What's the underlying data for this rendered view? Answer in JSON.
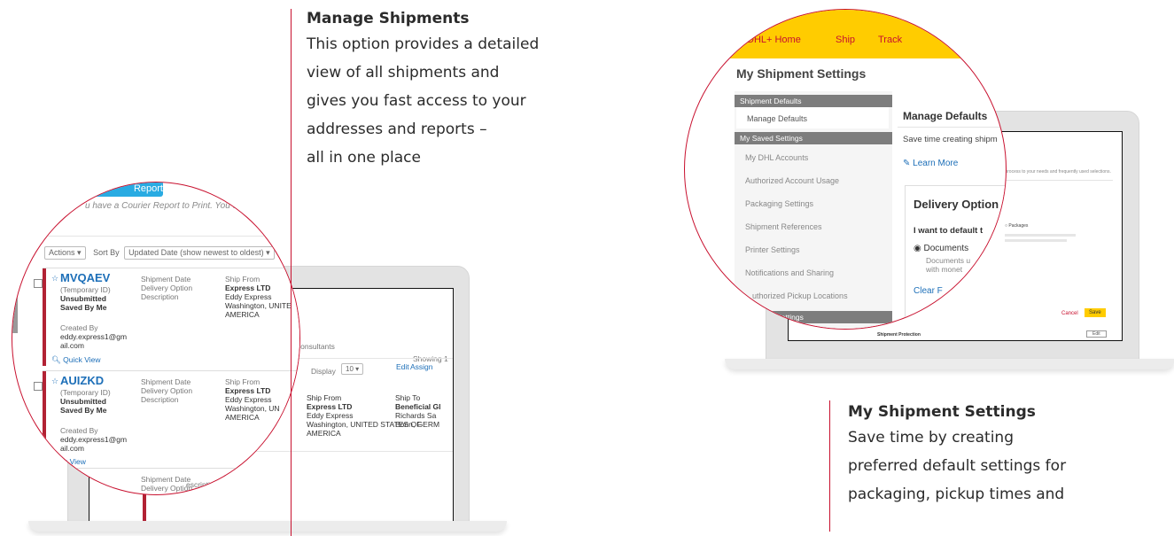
{
  "captions": {
    "manage": {
      "title": "Manage Shipments",
      "lines": [
        "This option provides a detailed",
        "view of all shipments and",
        "gives you fast access to your",
        "addresses and reports –",
        "all in one place"
      ]
    },
    "settings": {
      "title": "My Shipment Settings",
      "lines": [
        "Save time by creating",
        "preferred default settings for",
        "packaging, pickup times and"
      ]
    }
  },
  "colors": {
    "accent": "#c8102e",
    "dhl_yellow": "#ffcc00",
    "link": "#1d6fb8"
  },
  "left_zoom": {
    "top_button": "Report",
    "notice": "u have a Courier Report to Print. You do not have any",
    "toolbar": {
      "actions": "Actions ▾",
      "sort_by": "Sort By",
      "sort_value": "Updated Date (show newest to oldest)  ▾"
    },
    "shipments": [
      {
        "id": "MVQAEV",
        "temp_id": "(Temporary ID)",
        "status": "Unsubmitted",
        "saved_by": "Saved By Me",
        "fields": [
          "Shipment Date",
          "Delivery Option",
          "Description"
        ],
        "ship_from_label": "Ship From",
        "ship_from": [
          "Express LTD",
          "Eddy Express",
          "Washington, UNITE",
          "AMERICA"
        ],
        "created_label": "Created By",
        "created_by": "eddy.express1@gm",
        "created_by2": "ail.com",
        "quick_view": "Quick View"
      },
      {
        "id": "AUIZKD",
        "temp_id": "(Temporary ID)",
        "status": "Unsubmitted",
        "saved_by": "Saved By Me",
        "fields": [
          "Shipment Date",
          "Delivery Option",
          "Description"
        ],
        "ship_from_label": "Ship From",
        "ship_from": [
          "Express LTD",
          "Eddy Express",
          "Washington, UN",
          "AMERICA"
        ],
        "created_label": "Created By",
        "created_by": "eddy.express1@gm",
        "created_by2": "ail.com",
        "quick_view": "k View"
      }
    ],
    "third_row": {
      "fields": [
        "Shipment Date",
        "Delivery Option"
      ],
      "description": "escription"
    }
  },
  "left_screen": {
    "display_label": "Display",
    "display_value": "10 ▾",
    "showing": "Showing 1",
    "consultants": "Consultants",
    "from_label": "Ship From",
    "from_lines": [
      "Express LTD",
      "Eddy Express",
      "Washington, UNITED STATES OF",
      "AMERICA"
    ],
    "to_label": "Ship To",
    "to_lines": [
      "Beneficial Gl",
      "Richards Sa",
      "Bonn, GERM"
    ],
    "edit": "Edit",
    "assign": "Assign"
  },
  "right_zoom": {
    "nav": [
      "DHL+ Home",
      "Ship",
      "Track"
    ],
    "page_title": "My Shipment Settings",
    "sidebar": {
      "section1": "Shipment Defaults",
      "active_item": "Manage Defaults",
      "section2": "My Saved Settings",
      "items": [
        "My DHL Accounts",
        "Authorized Account Usage",
        "Packaging Settings",
        "Shipment References",
        "Printer Settings",
        "Notifications and Sharing",
        "uthorized Pickup Locations"
      ],
      "section3": "Clearance Settings"
    },
    "panel": {
      "title": "Manage Defaults",
      "subtitle": "Save time creating shipm",
      "learn_more": "Learn More",
      "delivery_title": "Delivery Option",
      "default_prompt": "I want to default t",
      "option": "Documents",
      "option_sub1": "Documents u",
      "option_sub2": "with monet",
      "clear": "Clear F"
    }
  },
  "right_screen": {
    "note": "the process to your needs and frequently used selections.",
    "packages": "Packages",
    "cancel": "Cancel",
    "save": "Save",
    "protection": "Shipment Protection",
    "edit": "Edit"
  }
}
